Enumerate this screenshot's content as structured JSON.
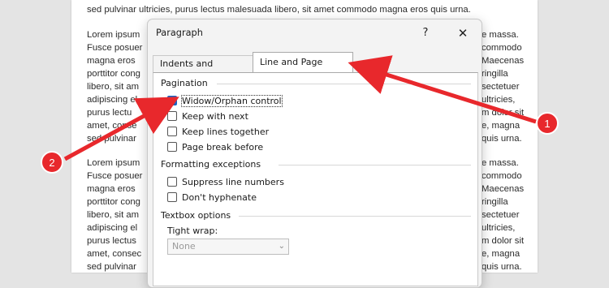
{
  "document": {
    "top_line": "sed pulvinar ultricies, purus lectus malesuada libero, sit amet commodo magna eros quis urna.",
    "left_fragments_1": [
      "Lorem ipsum",
      "Fusce posuer",
      "magna eros",
      "porttitor cong",
      "libero, sit am",
      "adipiscing el",
      "purus lectu",
      "amet, conse",
      "sed pulvinar"
    ],
    "right_fragments_1": [
      "e massa.",
      "commodo",
      "Maecenas",
      "ringilla",
      "sectetuer",
      "ultricies,",
      "m dolor sit",
      "e, magna",
      "quis urna."
    ],
    "left_fragments_2": [
      "Lorem ipsum",
      "Fusce posuer",
      "magna eros",
      "porttitor cong",
      "libero, sit am",
      "adipiscing el",
      "purus lectus",
      "amet, consec",
      "sed pulvinar"
    ],
    "right_fragments_2": [
      "e massa.",
      "commodo",
      "Maecenas",
      "ringilla",
      "sectetuer",
      "ultricies,",
      "m dolor sit",
      "e, magna",
      "quis urna."
    ]
  },
  "dialog": {
    "title": "Paragraph",
    "help": "?",
    "close": "✕",
    "tabs": [
      {
        "label": "Indents and Spacing",
        "active": false
      },
      {
        "label": "Line and Page Breaks",
        "active": true
      }
    ],
    "pagination": {
      "label": "Pagination",
      "options": [
        {
          "label": "Widow/Orphan control",
          "checked": true
        },
        {
          "label": "Keep with next",
          "checked": false
        },
        {
          "label": "Keep lines together",
          "checked": false
        },
        {
          "label": "Page break before",
          "checked": false
        }
      ]
    },
    "formatting_exceptions": {
      "label": "Formatting exceptions",
      "options": [
        {
          "label": "Suppress line numbers",
          "checked": false
        },
        {
          "label": "Don't hyphenate",
          "checked": false
        }
      ]
    },
    "textbox_options": {
      "label": "Textbox options",
      "tight_wrap_label": "Tight wrap:",
      "tight_wrap_value": "None"
    }
  },
  "callouts": [
    {
      "number": "1"
    },
    {
      "number": "2"
    }
  ],
  "colors": {
    "callout_red": "#e8282c",
    "checkbox_blue": "#1b64c1"
  }
}
